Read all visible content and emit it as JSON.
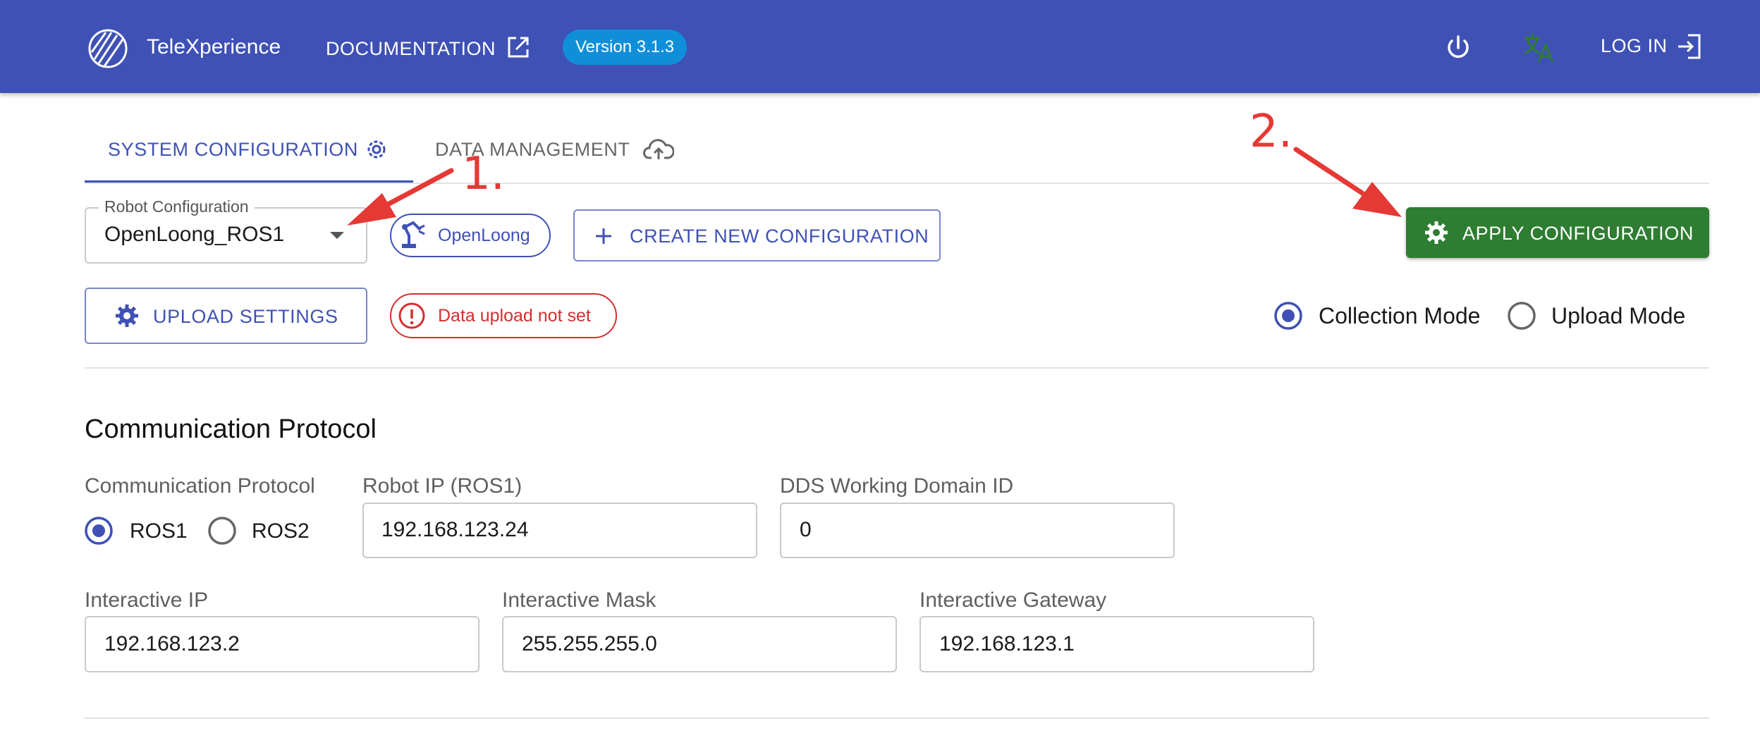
{
  "appbar": {
    "brand": "TeleXperience",
    "documentation": "DOCUMENTATION",
    "version": "Version 3.1.3",
    "login": "LOG IN"
  },
  "tabs": [
    {
      "label": "SYSTEM CONFIGURATION",
      "active": true
    },
    {
      "label": "DATA MANAGEMENT",
      "active": false
    }
  ],
  "robot_config": {
    "label": "Robot Configuration",
    "value": "OpenLoong_ROS1",
    "chip": "OpenLoong",
    "create_button": "CREATE NEW CONFIGURATION",
    "apply_button": "APPLY CONFIGURATION"
  },
  "upload": {
    "settings_button": "UPLOAD SETTINGS",
    "status": "Data upload not set"
  },
  "mode": {
    "options": [
      "Collection Mode",
      "Upload Mode"
    ],
    "selected": "Collection Mode"
  },
  "communication": {
    "section_title": "Communication Protocol",
    "protocol_label": "Communication Protocol",
    "protocols": [
      "ROS1",
      "ROS2"
    ],
    "selected_protocol": "ROS1",
    "robot_ip_label": "Robot IP (ROS1)",
    "robot_ip": "192.168.123.24",
    "dds_label": "DDS Working Domain ID",
    "dds_value": "0",
    "interactive_ip_label": "Interactive IP",
    "interactive_ip": "192.168.123.2",
    "interactive_mask_label": "Interactive Mask",
    "interactive_mask": "255.255.255.0",
    "interactive_gateway_label": "Interactive Gateway",
    "interactive_gateway": "192.168.123.1"
  },
  "annotations": [
    "1.",
    "2."
  ],
  "colors": {
    "primary": "#3f51b5",
    "apply_green": "#2e7d32",
    "version_badge": "#0f8fd9",
    "error": "#d32f2f",
    "annotation_red": "#e53935"
  }
}
